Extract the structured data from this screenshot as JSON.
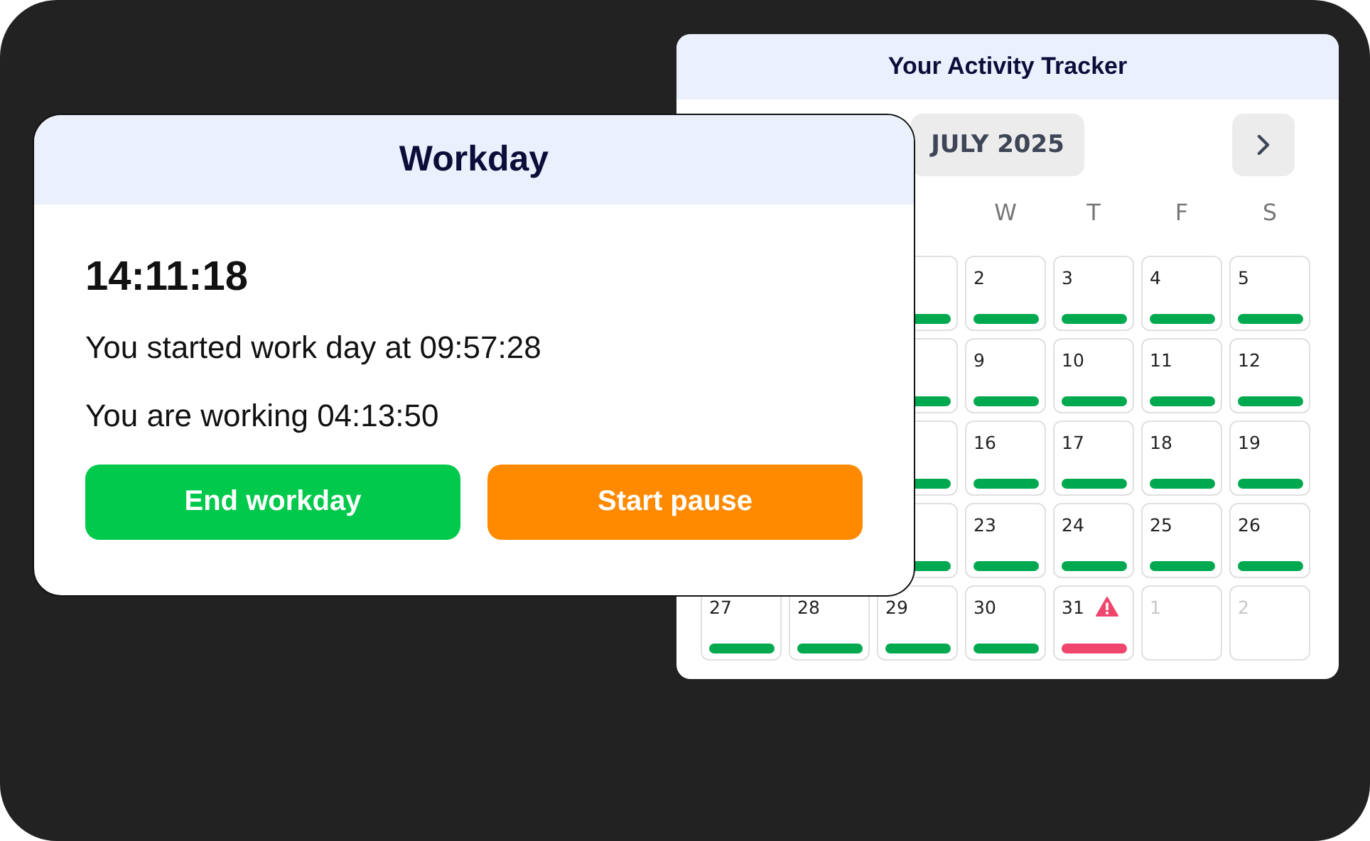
{
  "tracker": {
    "title": "Your Activity Tracker",
    "month": "JULY 2025",
    "weekdays": [
      "W",
      "T",
      "F",
      "S"
    ],
    "cells": [
      {
        "kind": "covered"
      },
      {
        "kind": "covered"
      },
      {
        "kind": "day",
        "color": "#00a94f",
        "warning": false
      },
      {
        "kind": "day",
        "day": "2",
        "color": "#00a94f",
        "warning": false
      },
      {
        "kind": "day",
        "day": "3",
        "color": "#00a94f",
        "warning": false
      },
      {
        "kind": "day",
        "day": "4",
        "color": "#00a94f",
        "warning": false
      },
      {
        "kind": "day",
        "day": "5",
        "color": "#00a94f",
        "warning": false
      },
      {
        "kind": "covered"
      },
      {
        "kind": "covered"
      },
      {
        "kind": "day",
        "color": "#00a94f",
        "warning": false
      },
      {
        "kind": "day",
        "day": "9",
        "color": "#00a94f",
        "warning": false
      },
      {
        "kind": "day",
        "day": "10",
        "color": "#00a94f",
        "warning": false
      },
      {
        "kind": "day",
        "day": "11",
        "color": "#00a94f",
        "warning": false
      },
      {
        "kind": "day",
        "day": "12",
        "color": "#00a94f",
        "warning": false
      },
      {
        "kind": "covered"
      },
      {
        "kind": "covered"
      },
      {
        "kind": "day",
        "color": "#00a94f",
        "warning": false
      },
      {
        "kind": "day",
        "day": "16",
        "color": "#00a94f",
        "warning": false
      },
      {
        "kind": "day",
        "day": "17",
        "color": "#00a94f",
        "warning": false
      },
      {
        "kind": "day",
        "day": "18",
        "color": "#00a94f",
        "warning": false
      },
      {
        "kind": "day",
        "day": "19",
        "color": "#00a94f",
        "warning": false
      },
      {
        "kind": "covered"
      },
      {
        "kind": "covered"
      },
      {
        "kind": "day",
        "color": "#00a94f",
        "warning": false
      },
      {
        "kind": "day",
        "day": "23",
        "color": "#00a94f",
        "warning": false
      },
      {
        "kind": "day",
        "day": "24",
        "color": "#00a94f",
        "warning": false
      },
      {
        "kind": "day",
        "day": "25",
        "color": "#00a94f",
        "warning": false
      },
      {
        "kind": "day",
        "day": "26",
        "color": "#00a94f",
        "warning": false
      },
      {
        "kind": "day",
        "day": "27",
        "color": "#00a94f",
        "warning": false
      },
      {
        "kind": "day",
        "day": "28",
        "color": "#00a94f",
        "warning": false
      },
      {
        "kind": "day",
        "day": "29",
        "color": "#00a94f",
        "warning": false
      },
      {
        "kind": "day",
        "day": "30",
        "color": "#00a94f",
        "warning": false
      },
      {
        "kind": "day",
        "day": "31",
        "color": "#f0466e",
        "warning": true
      },
      {
        "kind": "other_month",
        "day": "1"
      },
      {
        "kind": "other_month",
        "day": "2"
      }
    ]
  },
  "workday": {
    "title": "Workday",
    "clock": "14:11:18",
    "started": "You started work day at 09:57:28",
    "working": "You are working 04:13:50",
    "buttons": [
      {
        "label": "End workday",
        "kind": "end"
      },
      {
        "label": "Start pause",
        "kind": "pause"
      }
    ]
  }
}
